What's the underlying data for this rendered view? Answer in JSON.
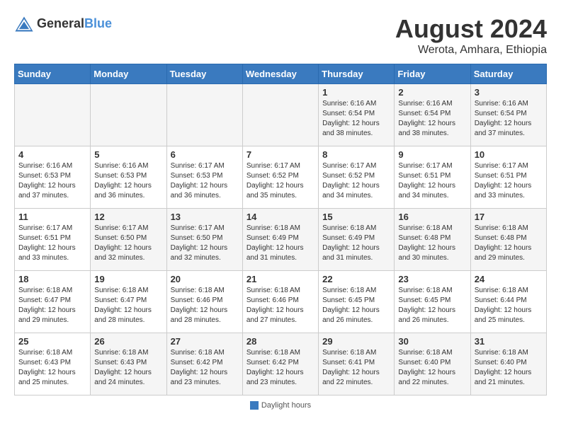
{
  "header": {
    "logo_general": "General",
    "logo_blue": "Blue",
    "month_year": "August 2024",
    "location": "Werota, Amhara, Ethiopia"
  },
  "days_of_week": [
    "Sunday",
    "Monday",
    "Tuesday",
    "Wednesday",
    "Thursday",
    "Friday",
    "Saturday"
  ],
  "weeks": [
    [
      {
        "day": "",
        "info": ""
      },
      {
        "day": "",
        "info": ""
      },
      {
        "day": "",
        "info": ""
      },
      {
        "day": "",
        "info": ""
      },
      {
        "day": "1",
        "info": "Sunrise: 6:16 AM\nSunset: 6:54 PM\nDaylight: 12 hours\nand 38 minutes."
      },
      {
        "day": "2",
        "info": "Sunrise: 6:16 AM\nSunset: 6:54 PM\nDaylight: 12 hours\nand 38 minutes."
      },
      {
        "day": "3",
        "info": "Sunrise: 6:16 AM\nSunset: 6:54 PM\nDaylight: 12 hours\nand 37 minutes."
      }
    ],
    [
      {
        "day": "4",
        "info": "Sunrise: 6:16 AM\nSunset: 6:53 PM\nDaylight: 12 hours\nand 37 minutes."
      },
      {
        "day": "5",
        "info": "Sunrise: 6:16 AM\nSunset: 6:53 PM\nDaylight: 12 hours\nand 36 minutes."
      },
      {
        "day": "6",
        "info": "Sunrise: 6:17 AM\nSunset: 6:53 PM\nDaylight: 12 hours\nand 36 minutes."
      },
      {
        "day": "7",
        "info": "Sunrise: 6:17 AM\nSunset: 6:52 PM\nDaylight: 12 hours\nand 35 minutes."
      },
      {
        "day": "8",
        "info": "Sunrise: 6:17 AM\nSunset: 6:52 PM\nDaylight: 12 hours\nand 34 minutes."
      },
      {
        "day": "9",
        "info": "Sunrise: 6:17 AM\nSunset: 6:51 PM\nDaylight: 12 hours\nand 34 minutes."
      },
      {
        "day": "10",
        "info": "Sunrise: 6:17 AM\nSunset: 6:51 PM\nDaylight: 12 hours\nand 33 minutes."
      }
    ],
    [
      {
        "day": "11",
        "info": "Sunrise: 6:17 AM\nSunset: 6:51 PM\nDaylight: 12 hours\nand 33 minutes."
      },
      {
        "day": "12",
        "info": "Sunrise: 6:17 AM\nSunset: 6:50 PM\nDaylight: 12 hours\nand 32 minutes."
      },
      {
        "day": "13",
        "info": "Sunrise: 6:17 AM\nSunset: 6:50 PM\nDaylight: 12 hours\nand 32 minutes."
      },
      {
        "day": "14",
        "info": "Sunrise: 6:18 AM\nSunset: 6:49 PM\nDaylight: 12 hours\nand 31 minutes."
      },
      {
        "day": "15",
        "info": "Sunrise: 6:18 AM\nSunset: 6:49 PM\nDaylight: 12 hours\nand 31 minutes."
      },
      {
        "day": "16",
        "info": "Sunrise: 6:18 AM\nSunset: 6:48 PM\nDaylight: 12 hours\nand 30 minutes."
      },
      {
        "day": "17",
        "info": "Sunrise: 6:18 AM\nSunset: 6:48 PM\nDaylight: 12 hours\nand 29 minutes."
      }
    ],
    [
      {
        "day": "18",
        "info": "Sunrise: 6:18 AM\nSunset: 6:47 PM\nDaylight: 12 hours\nand 29 minutes."
      },
      {
        "day": "19",
        "info": "Sunrise: 6:18 AM\nSunset: 6:47 PM\nDaylight: 12 hours\nand 28 minutes."
      },
      {
        "day": "20",
        "info": "Sunrise: 6:18 AM\nSunset: 6:46 PM\nDaylight: 12 hours\nand 28 minutes."
      },
      {
        "day": "21",
        "info": "Sunrise: 6:18 AM\nSunset: 6:46 PM\nDaylight: 12 hours\nand 27 minutes."
      },
      {
        "day": "22",
        "info": "Sunrise: 6:18 AM\nSunset: 6:45 PM\nDaylight: 12 hours\nand 26 minutes."
      },
      {
        "day": "23",
        "info": "Sunrise: 6:18 AM\nSunset: 6:45 PM\nDaylight: 12 hours\nand 26 minutes."
      },
      {
        "day": "24",
        "info": "Sunrise: 6:18 AM\nSunset: 6:44 PM\nDaylight: 12 hours\nand 25 minutes."
      }
    ],
    [
      {
        "day": "25",
        "info": "Sunrise: 6:18 AM\nSunset: 6:43 PM\nDaylight: 12 hours\nand 25 minutes."
      },
      {
        "day": "26",
        "info": "Sunrise: 6:18 AM\nSunset: 6:43 PM\nDaylight: 12 hours\nand 24 minutes."
      },
      {
        "day": "27",
        "info": "Sunrise: 6:18 AM\nSunset: 6:42 PM\nDaylight: 12 hours\nand 23 minutes."
      },
      {
        "day": "28",
        "info": "Sunrise: 6:18 AM\nSunset: 6:42 PM\nDaylight: 12 hours\nand 23 minutes."
      },
      {
        "day": "29",
        "info": "Sunrise: 6:18 AM\nSunset: 6:41 PM\nDaylight: 12 hours\nand 22 minutes."
      },
      {
        "day": "30",
        "info": "Sunrise: 6:18 AM\nSunset: 6:40 PM\nDaylight: 12 hours\nand 22 minutes."
      },
      {
        "day": "31",
        "info": "Sunrise: 6:18 AM\nSunset: 6:40 PM\nDaylight: 12 hours\nand 21 minutes."
      }
    ]
  ],
  "footer": {
    "daylight_label": "Daylight hours"
  }
}
